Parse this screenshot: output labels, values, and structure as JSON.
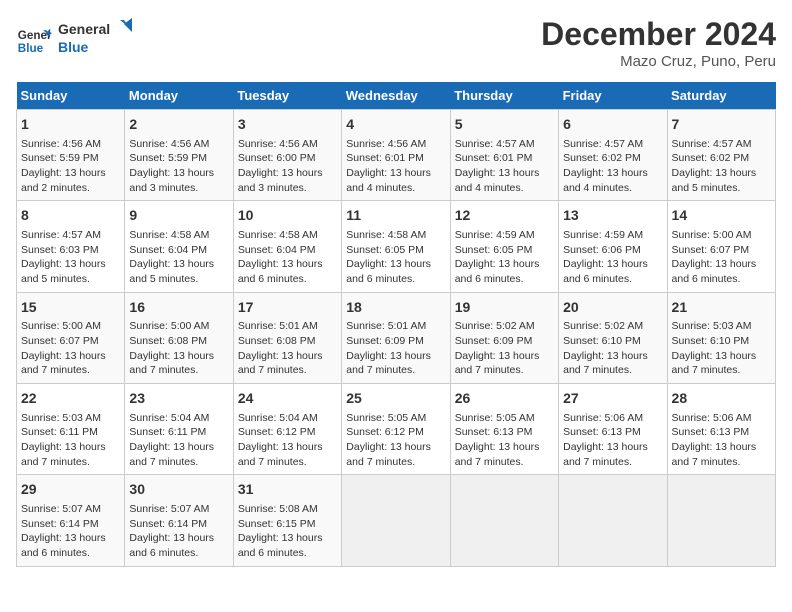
{
  "header": {
    "logo_line1": "General",
    "logo_line2": "Blue",
    "title": "December 2024",
    "subtitle": "Mazo Cruz, Puno, Peru"
  },
  "days_of_week": [
    "Sunday",
    "Monday",
    "Tuesday",
    "Wednesday",
    "Thursday",
    "Friday",
    "Saturday"
  ],
  "weeks": [
    [
      {
        "day": 1,
        "lines": [
          "Sunrise: 4:56 AM",
          "Sunset: 5:59 PM",
          "Daylight: 13 hours",
          "and 2 minutes."
        ]
      },
      {
        "day": 2,
        "lines": [
          "Sunrise: 4:56 AM",
          "Sunset: 5:59 PM",
          "Daylight: 13 hours",
          "and 3 minutes."
        ]
      },
      {
        "day": 3,
        "lines": [
          "Sunrise: 4:56 AM",
          "Sunset: 6:00 PM",
          "Daylight: 13 hours",
          "and 3 minutes."
        ]
      },
      {
        "day": 4,
        "lines": [
          "Sunrise: 4:56 AM",
          "Sunset: 6:01 PM",
          "Daylight: 13 hours",
          "and 4 minutes."
        ]
      },
      {
        "day": 5,
        "lines": [
          "Sunrise: 4:57 AM",
          "Sunset: 6:01 PM",
          "Daylight: 13 hours",
          "and 4 minutes."
        ]
      },
      {
        "day": 6,
        "lines": [
          "Sunrise: 4:57 AM",
          "Sunset: 6:02 PM",
          "Daylight: 13 hours",
          "and 4 minutes."
        ]
      },
      {
        "day": 7,
        "lines": [
          "Sunrise: 4:57 AM",
          "Sunset: 6:02 PM",
          "Daylight: 13 hours",
          "and 5 minutes."
        ]
      }
    ],
    [
      {
        "day": 8,
        "lines": [
          "Sunrise: 4:57 AM",
          "Sunset: 6:03 PM",
          "Daylight: 13 hours",
          "and 5 minutes."
        ]
      },
      {
        "day": 9,
        "lines": [
          "Sunrise: 4:58 AM",
          "Sunset: 6:04 PM",
          "Daylight: 13 hours",
          "and 5 minutes."
        ]
      },
      {
        "day": 10,
        "lines": [
          "Sunrise: 4:58 AM",
          "Sunset: 6:04 PM",
          "Daylight: 13 hours",
          "and 6 minutes."
        ]
      },
      {
        "day": 11,
        "lines": [
          "Sunrise: 4:58 AM",
          "Sunset: 6:05 PM",
          "Daylight: 13 hours",
          "and 6 minutes."
        ]
      },
      {
        "day": 12,
        "lines": [
          "Sunrise: 4:59 AM",
          "Sunset: 6:05 PM",
          "Daylight: 13 hours",
          "and 6 minutes."
        ]
      },
      {
        "day": 13,
        "lines": [
          "Sunrise: 4:59 AM",
          "Sunset: 6:06 PM",
          "Daylight: 13 hours",
          "and 6 minutes."
        ]
      },
      {
        "day": 14,
        "lines": [
          "Sunrise: 5:00 AM",
          "Sunset: 6:07 PM",
          "Daylight: 13 hours",
          "and 6 minutes."
        ]
      }
    ],
    [
      {
        "day": 15,
        "lines": [
          "Sunrise: 5:00 AM",
          "Sunset: 6:07 PM",
          "Daylight: 13 hours",
          "and 7 minutes."
        ]
      },
      {
        "day": 16,
        "lines": [
          "Sunrise: 5:00 AM",
          "Sunset: 6:08 PM",
          "Daylight: 13 hours",
          "and 7 minutes."
        ]
      },
      {
        "day": 17,
        "lines": [
          "Sunrise: 5:01 AM",
          "Sunset: 6:08 PM",
          "Daylight: 13 hours",
          "and 7 minutes."
        ]
      },
      {
        "day": 18,
        "lines": [
          "Sunrise: 5:01 AM",
          "Sunset: 6:09 PM",
          "Daylight: 13 hours",
          "and 7 minutes."
        ]
      },
      {
        "day": 19,
        "lines": [
          "Sunrise: 5:02 AM",
          "Sunset: 6:09 PM",
          "Daylight: 13 hours",
          "and 7 minutes."
        ]
      },
      {
        "day": 20,
        "lines": [
          "Sunrise: 5:02 AM",
          "Sunset: 6:10 PM",
          "Daylight: 13 hours",
          "and 7 minutes."
        ]
      },
      {
        "day": 21,
        "lines": [
          "Sunrise: 5:03 AM",
          "Sunset: 6:10 PM",
          "Daylight: 13 hours",
          "and 7 minutes."
        ]
      }
    ],
    [
      {
        "day": 22,
        "lines": [
          "Sunrise: 5:03 AM",
          "Sunset: 6:11 PM",
          "Daylight: 13 hours",
          "and 7 minutes."
        ]
      },
      {
        "day": 23,
        "lines": [
          "Sunrise: 5:04 AM",
          "Sunset: 6:11 PM",
          "Daylight: 13 hours",
          "and 7 minutes."
        ]
      },
      {
        "day": 24,
        "lines": [
          "Sunrise: 5:04 AM",
          "Sunset: 6:12 PM",
          "Daylight: 13 hours",
          "and 7 minutes."
        ]
      },
      {
        "day": 25,
        "lines": [
          "Sunrise: 5:05 AM",
          "Sunset: 6:12 PM",
          "Daylight: 13 hours",
          "and 7 minutes."
        ]
      },
      {
        "day": 26,
        "lines": [
          "Sunrise: 5:05 AM",
          "Sunset: 6:13 PM",
          "Daylight: 13 hours",
          "and 7 minutes."
        ]
      },
      {
        "day": 27,
        "lines": [
          "Sunrise: 5:06 AM",
          "Sunset: 6:13 PM",
          "Daylight: 13 hours",
          "and 7 minutes."
        ]
      },
      {
        "day": 28,
        "lines": [
          "Sunrise: 5:06 AM",
          "Sunset: 6:13 PM",
          "Daylight: 13 hours",
          "and 7 minutes."
        ]
      }
    ],
    [
      {
        "day": 29,
        "lines": [
          "Sunrise: 5:07 AM",
          "Sunset: 6:14 PM",
          "Daylight: 13 hours",
          "and 6 minutes."
        ]
      },
      {
        "day": 30,
        "lines": [
          "Sunrise: 5:07 AM",
          "Sunset: 6:14 PM",
          "Daylight: 13 hours",
          "and 6 minutes."
        ]
      },
      {
        "day": 31,
        "lines": [
          "Sunrise: 5:08 AM",
          "Sunset: 6:15 PM",
          "Daylight: 13 hours",
          "and 6 minutes."
        ]
      },
      null,
      null,
      null,
      null
    ]
  ]
}
